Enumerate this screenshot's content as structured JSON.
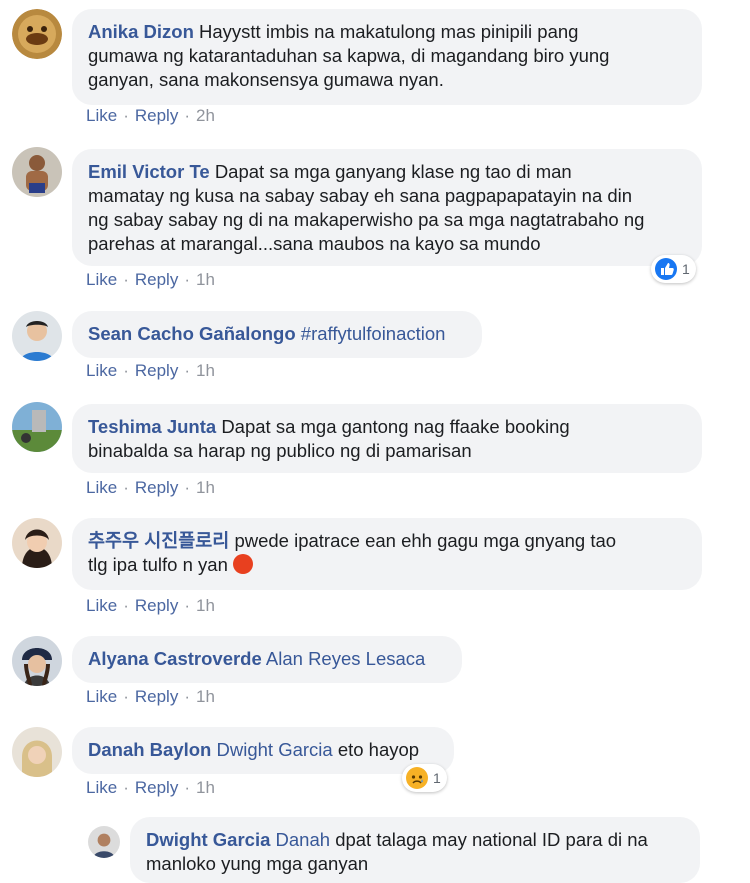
{
  "comments": [
    {
      "author": "Anika Dizon",
      "text": "Hayystt imbis na makatulong mas pinipili pang gumawa ng katarantaduhan sa kapwa, di magandang biro yung ganyan, sana makonsensya gumawa nyan.",
      "line1": "Hayystt imbis na makatulong mas pinipili pang",
      "line2": "gumawa ng katarantaduhan sa kapwa, di magandang biro yung",
      "line3": "ganyan, sana makonsensya gumawa nyan.",
      "like": "Like",
      "reply": "Reply",
      "time": "2h"
    },
    {
      "author": "Emil Victor Te",
      "line1": "Dapat sa mga ganyang klase ng tao di man",
      "line2": "mamatay ng kusa na sabay sabay eh sana pagpapapatayin na din",
      "line3": "ng sabay sabay ng di na makaperwisho pa sa mga nagtatrabaho ng",
      "line4": "parehas at marangal...sana maubos na kayo sa mundo",
      "like": "Like",
      "reply": "Reply",
      "time": "1h",
      "reaction_count": "1"
    },
    {
      "author": "Sean Cacho Gañalongo",
      "tag": "#raffytulfoinaction",
      "like": "Like",
      "reply": "Reply",
      "time": "1h"
    },
    {
      "author": "Teshima Junta",
      "line1": "Dapat sa mga gantong nag ffaake booking",
      "line2": "binabalda sa harap ng publico ng di pamarisan",
      "like": "Like",
      "reply": "Reply",
      "time": "1h"
    },
    {
      "author": "추주우 시진플로리",
      "line1": "pwede ipatrace ean ehh gagu mga gnyang tao",
      "line2": "tlg ipa tulfo n yan",
      "like": "Like",
      "reply": "Reply",
      "time": "1h"
    },
    {
      "author": "Alyana Castroverde",
      "tag": "Alan Reyes Lesaca",
      "like": "Like",
      "reply": "Reply",
      "time": "1h"
    },
    {
      "author": "Danah Baylon",
      "tag": "Dwight Garcia",
      "text": "eto hayop",
      "like": "Like",
      "reply": "Reply",
      "time": "1h",
      "reaction_count": "1"
    }
  ],
  "reply": {
    "author": "Dwight Garcia",
    "tag": "Danah",
    "line1": "dpat talaga may national ID para di na",
    "line2": "manloko yung mga ganyan"
  },
  "colors": {
    "bubble": "#f2f3f5",
    "link": "#385898",
    "meta": "#90949c",
    "action": "#4b67a1"
  }
}
